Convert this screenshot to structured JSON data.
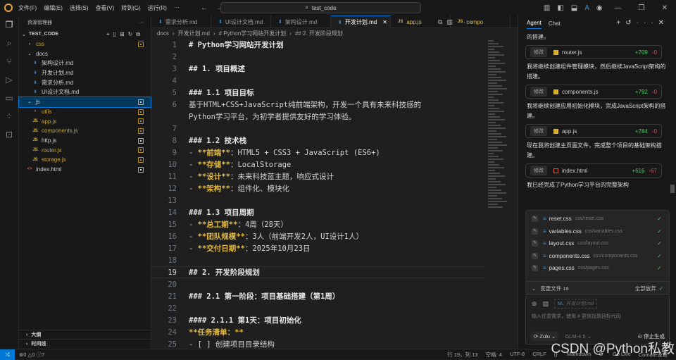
{
  "titlebar": {
    "menus": [
      "文件(F)",
      "编辑(E)",
      "选择(S)",
      "查看(V)",
      "转到(G)",
      "运行(R)",
      "···"
    ],
    "search": "test_code"
  },
  "sidebar": {
    "title": "资源管理器",
    "root": "TEST_CODE",
    "items": [
      {
        "label": "css",
        "depth": 1,
        "kind": "folder-closed",
        "mod": true,
        "mark": "y"
      },
      {
        "label": "docs",
        "depth": 1,
        "kind": "folder-open",
        "mod": false,
        "mark": ""
      },
      {
        "label": "架构设计.md",
        "depth": 2,
        "kind": "md",
        "mod": false,
        "mark": ""
      },
      {
        "label": "开发计划.md",
        "depth": 2,
        "kind": "md",
        "mod": false,
        "mark": ""
      },
      {
        "label": "需求分析.md",
        "depth": 2,
        "kind": "md",
        "mod": false,
        "mark": ""
      },
      {
        "label": "UI设计文档.md",
        "depth": 2,
        "kind": "md",
        "mod": false,
        "mark": ""
      },
      {
        "label": "js",
        "depth": 1,
        "kind": "folder-open",
        "mod": false,
        "mark": "w",
        "selected": true
      },
      {
        "label": "utils",
        "depth": 2,
        "kind": "folder-closed",
        "mod": true,
        "mark": "y"
      },
      {
        "label": "app.js",
        "depth": 2,
        "kind": "js",
        "mod": true,
        "mark": "y"
      },
      {
        "label": "components.js",
        "depth": 2,
        "kind": "js",
        "mod": true,
        "mark": "y"
      },
      {
        "label": "http.js",
        "depth": 2,
        "kind": "js",
        "mod": false,
        "mark": "w"
      },
      {
        "label": "router.js",
        "depth": 2,
        "kind": "js",
        "mod": true,
        "mark": "y"
      },
      {
        "label": "storage.js",
        "depth": 2,
        "kind": "js",
        "mod": true,
        "mark": "y"
      },
      {
        "label": "index.html",
        "depth": 1,
        "kind": "html",
        "mod": false,
        "mark": "w"
      }
    ],
    "outline": "大纲",
    "timeline": "时间线"
  },
  "tabs": [
    {
      "label": "需求分析.md",
      "kind": "md"
    },
    {
      "label": "UI设计文档.md",
      "kind": "md"
    },
    {
      "label": "架构设计.md",
      "kind": "md"
    },
    {
      "label": "开发计划.md",
      "kind": "md",
      "active": true
    },
    {
      "label": "app.js",
      "kind": "js"
    },
    {
      "label": "compo",
      "kind": "js"
    }
  ],
  "breadcrumb": [
    "docs",
    "开发计划.md",
    "# Python学习网站开发计划",
    "## 2. 开发阶段规划"
  ],
  "editor": {
    "current_line": 19,
    "lines": [
      {
        "n": "1",
        "s": [
          [
            "h",
            "# Python学习网站开发计划"
          ]
        ]
      },
      {
        "n": "2",
        "s": []
      },
      {
        "n": "3",
        "s": [
          [
            "h",
            "## 1. 项目概述"
          ]
        ]
      },
      {
        "n": "4",
        "s": []
      },
      {
        "n": "5",
        "s": [
          [
            "h",
            "### 1.1 项目目标"
          ]
        ]
      },
      {
        "n": "6",
        "s": [
          [
            "t",
            "基于HTML+CSS+JavaScript纯前端架构，开发一个具有未来科技感的"
          ]
        ]
      },
      {
        "n": "",
        "s": [
          [
            "t",
            "Python学习平台，为初学者提供友好的学习体验。"
          ]
        ]
      },
      {
        "n": "7",
        "s": []
      },
      {
        "n": "8",
        "s": [
          [
            "h",
            "### 1.2 技术栈"
          ]
        ]
      },
      {
        "n": "9",
        "s": [
          [
            "t",
            "- "
          ],
          [
            "b",
            "**前端**"
          ],
          [
            "t",
            "：HTML5 + CSS3 + JavaScript (ES6+)"
          ]
        ]
      },
      {
        "n": "10",
        "s": [
          [
            "t",
            "- "
          ],
          [
            "b",
            "**存储**"
          ],
          [
            "t",
            "：LocalStorage"
          ]
        ]
      },
      {
        "n": "11",
        "s": [
          [
            "t",
            "- "
          ],
          [
            "b",
            "**设计**"
          ],
          [
            "t",
            "：未来科技蓝主题，响应式设计"
          ]
        ]
      },
      {
        "n": "12",
        "s": [
          [
            "t",
            "- "
          ],
          [
            "b",
            "**架构**"
          ],
          [
            "t",
            "：组件化、模块化"
          ]
        ]
      },
      {
        "n": "13",
        "s": []
      },
      {
        "n": "14",
        "s": [
          [
            "h",
            "### 1.3 项目周期"
          ]
        ]
      },
      {
        "n": "15",
        "s": [
          [
            "t",
            "- "
          ],
          [
            "b",
            "**总工期**"
          ],
          [
            "t",
            "：4周（28天）"
          ]
        ]
      },
      {
        "n": "16",
        "s": [
          [
            "t",
            "- "
          ],
          [
            "b",
            "**团队规模**"
          ],
          [
            "t",
            "：3人（前端开发2人，UI设计1人）"
          ]
        ]
      },
      {
        "n": "17",
        "s": [
          [
            "t",
            "- "
          ],
          [
            "b",
            "**交付日期**"
          ],
          [
            "t",
            "：2025年10月23日"
          ]
        ]
      },
      {
        "n": "18",
        "s": []
      },
      {
        "n": "19",
        "s": [
          [
            "h",
            "## 2. 开发阶段规划"
          ]
        ]
      },
      {
        "n": "20",
        "s": []
      },
      {
        "n": "21",
        "s": [
          [
            "h",
            "### 2.1 第一阶段：项目基础搭建（第1周）"
          ]
        ]
      },
      {
        "n": "22",
        "s": []
      },
      {
        "n": "23",
        "s": [
          [
            "h",
            "#### 2.1.1 第1天：项目初始化"
          ]
        ]
      },
      {
        "n": "24",
        "s": [
          [
            "b",
            "**任务清单：**"
          ]
        ]
      },
      {
        "n": "25",
        "s": [
          [
            "t",
            "- [ ] 创建项目目录结构"
          ]
        ]
      }
    ]
  },
  "agent": {
    "tabs": [
      "Agent",
      "Chat"
    ],
    "feed": [
      {
        "type": "msg",
        "text": "的搭建。"
      },
      {
        "type": "card",
        "edit": "修改",
        "file": "router.js",
        "kind": "js",
        "add": "+709",
        "del": "-0"
      },
      {
        "type": "msg",
        "text": "我将继续创建组件管理模块，然后继续JavaScript架构的搭建。"
      },
      {
        "type": "card",
        "edit": "修改",
        "file": "components.js",
        "kind": "js",
        "add": "+792",
        "del": "-0"
      },
      {
        "type": "msg",
        "text": "我将继续创建应用初始化模块，完成JavaScript架构的搭建。"
      },
      {
        "type": "card",
        "edit": "修改",
        "file": "app.js",
        "kind": "js",
        "add": "+784",
        "del": "-0"
      },
      {
        "type": "msg",
        "text": "现在我将创建主页面文件，完成整个项目的基础架构搭建。"
      },
      {
        "type": "card",
        "edit": "修改",
        "file": "index.html",
        "kind": "html",
        "add": "+616",
        "del": "-67"
      },
      {
        "type": "msg",
        "text": "我已经完成了Python学习平台的完整架构"
      }
    ],
    "changes": [
      {
        "name": "reset.css",
        "path": "css/reset.css"
      },
      {
        "name": "variables.css",
        "path": "css/variables.css"
      },
      {
        "name": "layout.css",
        "path": "css/layout.css"
      },
      {
        "name": "components.css",
        "path": "css/components.css"
      },
      {
        "name": "pages.css",
        "path": "css/pages.css"
      }
    ],
    "changes_label": "变更文件 16",
    "discard_all": "全部放弃",
    "context_chip": "开发计划.md",
    "input_placeholder": "输入任意需求，使用 # 更快找到目标代码",
    "agent_mode": "Zulu",
    "model": "GLM-4.5",
    "stop": "停止生成"
  },
  "status": {
    "errors": "0",
    "warnings": "0",
    "info": "7",
    "position": "行 19，列 13",
    "spaces": "空格: 4",
    "encoding": "UTF-8",
    "eol": "CRLF",
    "language": "Markdown",
    "golive": "Go Live",
    "comate": "Comate设置"
  },
  "watermark": "CSDN @Python私教"
}
